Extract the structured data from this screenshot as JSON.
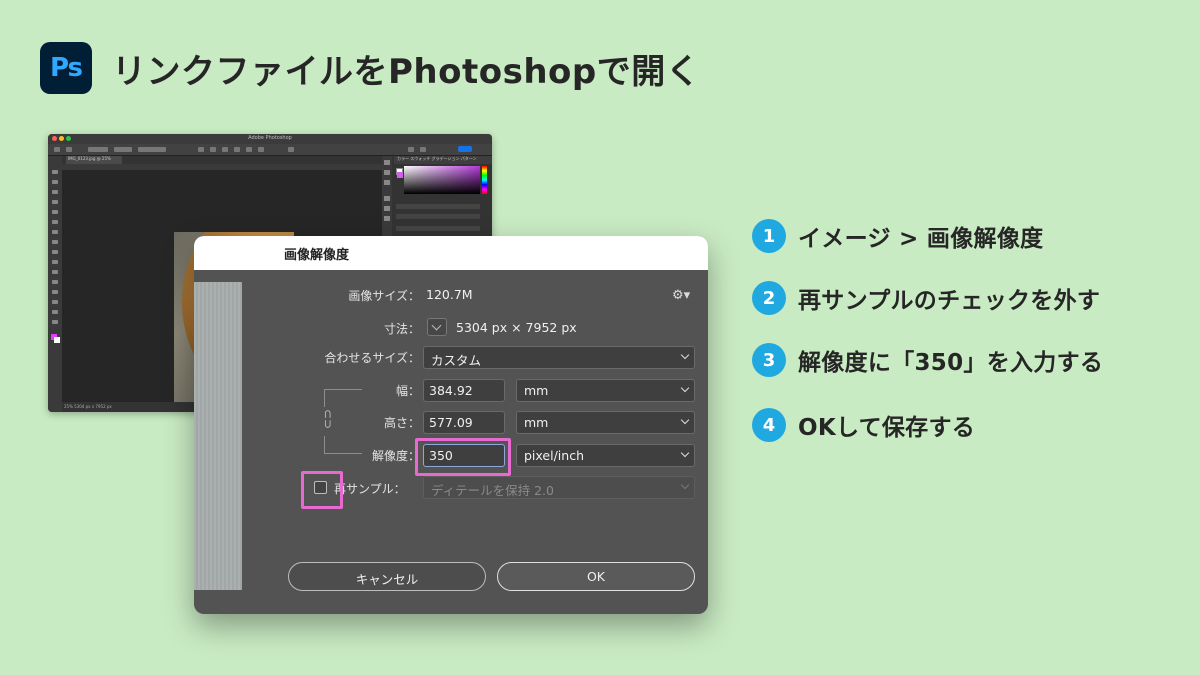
{
  "header": {
    "logo_text": "Ps",
    "title": "リンクファイルをPhotoshopで開く"
  },
  "ps_window": {
    "title": "Adobe Photoshop",
    "doc_tab": "IMG_0123.jpg @ 25%",
    "panel_tabs": "カラー  スウォッチ  グラデーション  パターン",
    "status": "25%  5304 px x 7952 px"
  },
  "dialog": {
    "title": "画像解像度",
    "image_size_label": "画像サイズ：",
    "image_size_value": "120.7M",
    "dimensions_label": "寸法：",
    "dimensions_value": "5304 px × 7952 px",
    "fit_label": "合わせるサイズ：",
    "fit_value": "カスタム",
    "width_label": "幅：",
    "width_value": "384.92",
    "width_unit": "mm",
    "height_label": "高さ：",
    "height_value": "577.09",
    "height_unit": "mm",
    "resolution_label": "解像度：",
    "resolution_value": "350",
    "resolution_unit": "pixel/inch",
    "resample_label": "再サンプル：",
    "resample_value": "ディテールを保持 2.0",
    "cancel_label": "キャンセル",
    "ok_label": "OK"
  },
  "steps": [
    {
      "num": "1",
      "text": "イメージ > 画像解像度"
    },
    {
      "num": "2",
      "text": "再サンプルのチェックを外す"
    },
    {
      "num": "3",
      "text": "解像度に「350」を入力する"
    },
    {
      "num": "4",
      "text": "OKして保存する"
    }
  ],
  "colors": {
    "background": "#c9ebc3",
    "step_badge": "#1fa9e0",
    "highlight": "#e66ad0",
    "ps_logo_bg": "#001e36",
    "ps_logo_fg": "#31a8ff"
  }
}
